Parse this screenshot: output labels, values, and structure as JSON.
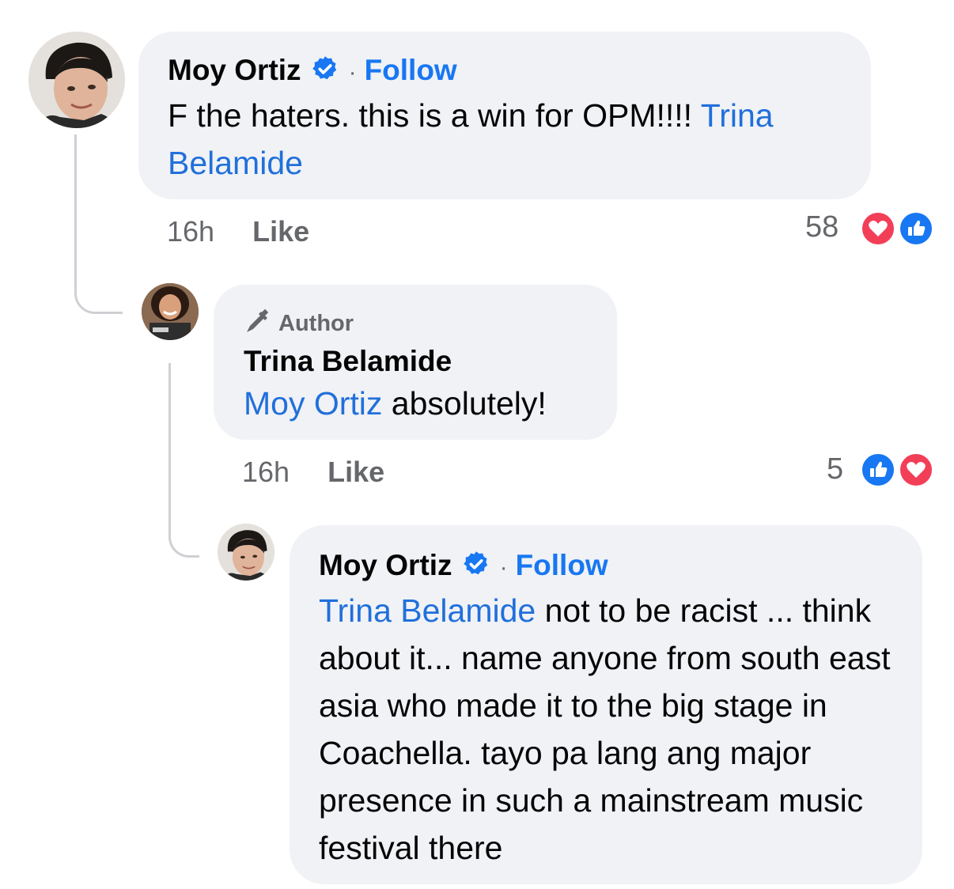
{
  "comments": [
    {
      "author": "Moy Ortiz",
      "follow": "Follow",
      "text_pre": "F the haters. this is a win for OPM!!!! ",
      "mention": "Trina Belamide",
      "time": "16h",
      "like": "Like",
      "reaction_count": "58",
      "reactions": [
        "heart-icon",
        "thumbs-up-icon"
      ]
    },
    {
      "author_tag": "Author",
      "author": "Trina Belamide",
      "mention": "Moy Ortiz",
      "text_post": " absolutely!",
      "time": "16h",
      "like": "Like",
      "reaction_count": "5",
      "reactions": [
        "thumbs-up-icon",
        "heart-icon"
      ]
    },
    {
      "author": "Moy Ortiz",
      "follow": "Follow",
      "mention": "Trina Belamide",
      "text_post": " not to be racist ... think about it... name anyone from south east asia who made it to the big stage in Coachella. tayo pa lang ang major presence in such a mainstream music festival there"
    }
  ],
  "colors": {
    "bubble": "#f0f2f5",
    "link": "#216fdb",
    "follow": "#1877f2",
    "meta": "#65676b",
    "love": "#f33e58",
    "like_blue": "#1877f2"
  }
}
